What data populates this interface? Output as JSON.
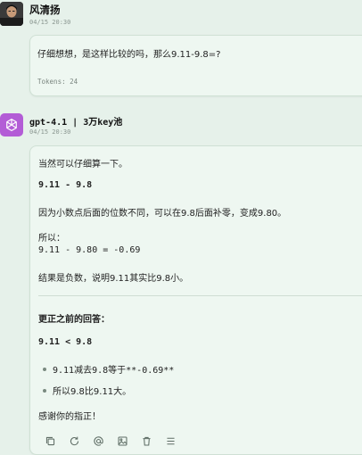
{
  "user_message": {
    "name": "风清扬",
    "time": "04/15 20:30",
    "text": "仔细想想，是这样比较的吗，那么9.11-9.8=?",
    "tokens": "Tokens: 24"
  },
  "bot_message": {
    "model": "gpt-4.1 | 3万key池",
    "time": "04/15 20:30",
    "lines": {
      "l1": "当然可以仔细算一下。",
      "l2": "9.11 - 9.8",
      "l3": "因为小数点后面的位数不同，可以在9.8后面补零，变成9.80。",
      "l4": "所以：",
      "l5": "9.11 - 9.80 = -0.69",
      "l6": "结果是负数，说明9.11其实比9.8小。",
      "l7": "更正之前的回答：",
      "l8": "9.11 < 9.8",
      "b1": "9.11减去9.8等于**-0.69**",
      "b2": "所以9.8比9.11大。",
      "l9": "感谢你的指正！"
    }
  },
  "actions": [
    {
      "name": "copy-icon"
    },
    {
      "name": "regenerate-icon"
    },
    {
      "name": "mention-icon"
    },
    {
      "name": "image-icon"
    },
    {
      "name": "delete-icon"
    },
    {
      "name": "menu-icon"
    }
  ],
  "colors": {
    "background": "#e6f1ea",
    "bubble": "#eef7f1",
    "bot_avatar": "#b35cd6"
  }
}
